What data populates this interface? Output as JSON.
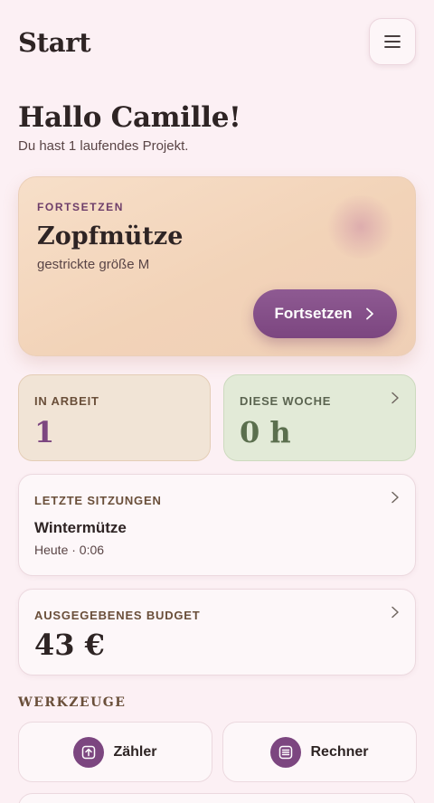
{
  "header": {
    "title": "Start",
    "menu_icon": "menu-icon"
  },
  "greeting": {
    "title": "Hallo Camille!",
    "subtitle": "Du hast 1 laufendes Projekt."
  },
  "hero": {
    "eyebrow": "FORTSETZEN",
    "project_name": "Zopfmütze",
    "project_detail": "gestrickte größe M",
    "button_label": "Fortsetzen",
    "button_icon": "chevron-right-icon"
  },
  "stats": {
    "in_progress": {
      "label": "IN ARBEIT",
      "value": "1"
    },
    "this_week": {
      "label": "DIESE WOCHE",
      "value": "0 h"
    }
  },
  "sessions": {
    "label": "LETZTE SITZUNGEN",
    "name": "Wintermütze",
    "meta": "Heute · 0:06"
  },
  "budget": {
    "label": "AUSGEGEBENES BUDGET",
    "value": "43 €"
  },
  "tools": {
    "section_title": "WERKZEUGE",
    "counter_label": "Zähler",
    "calculator_label": "Rechner"
  },
  "colors": {
    "background": "#fcf0f4",
    "accent": "#7c4680",
    "hero": "#f2d3b8",
    "in_progress": "#f1e4d6",
    "this_week": "#e2ead7"
  }
}
